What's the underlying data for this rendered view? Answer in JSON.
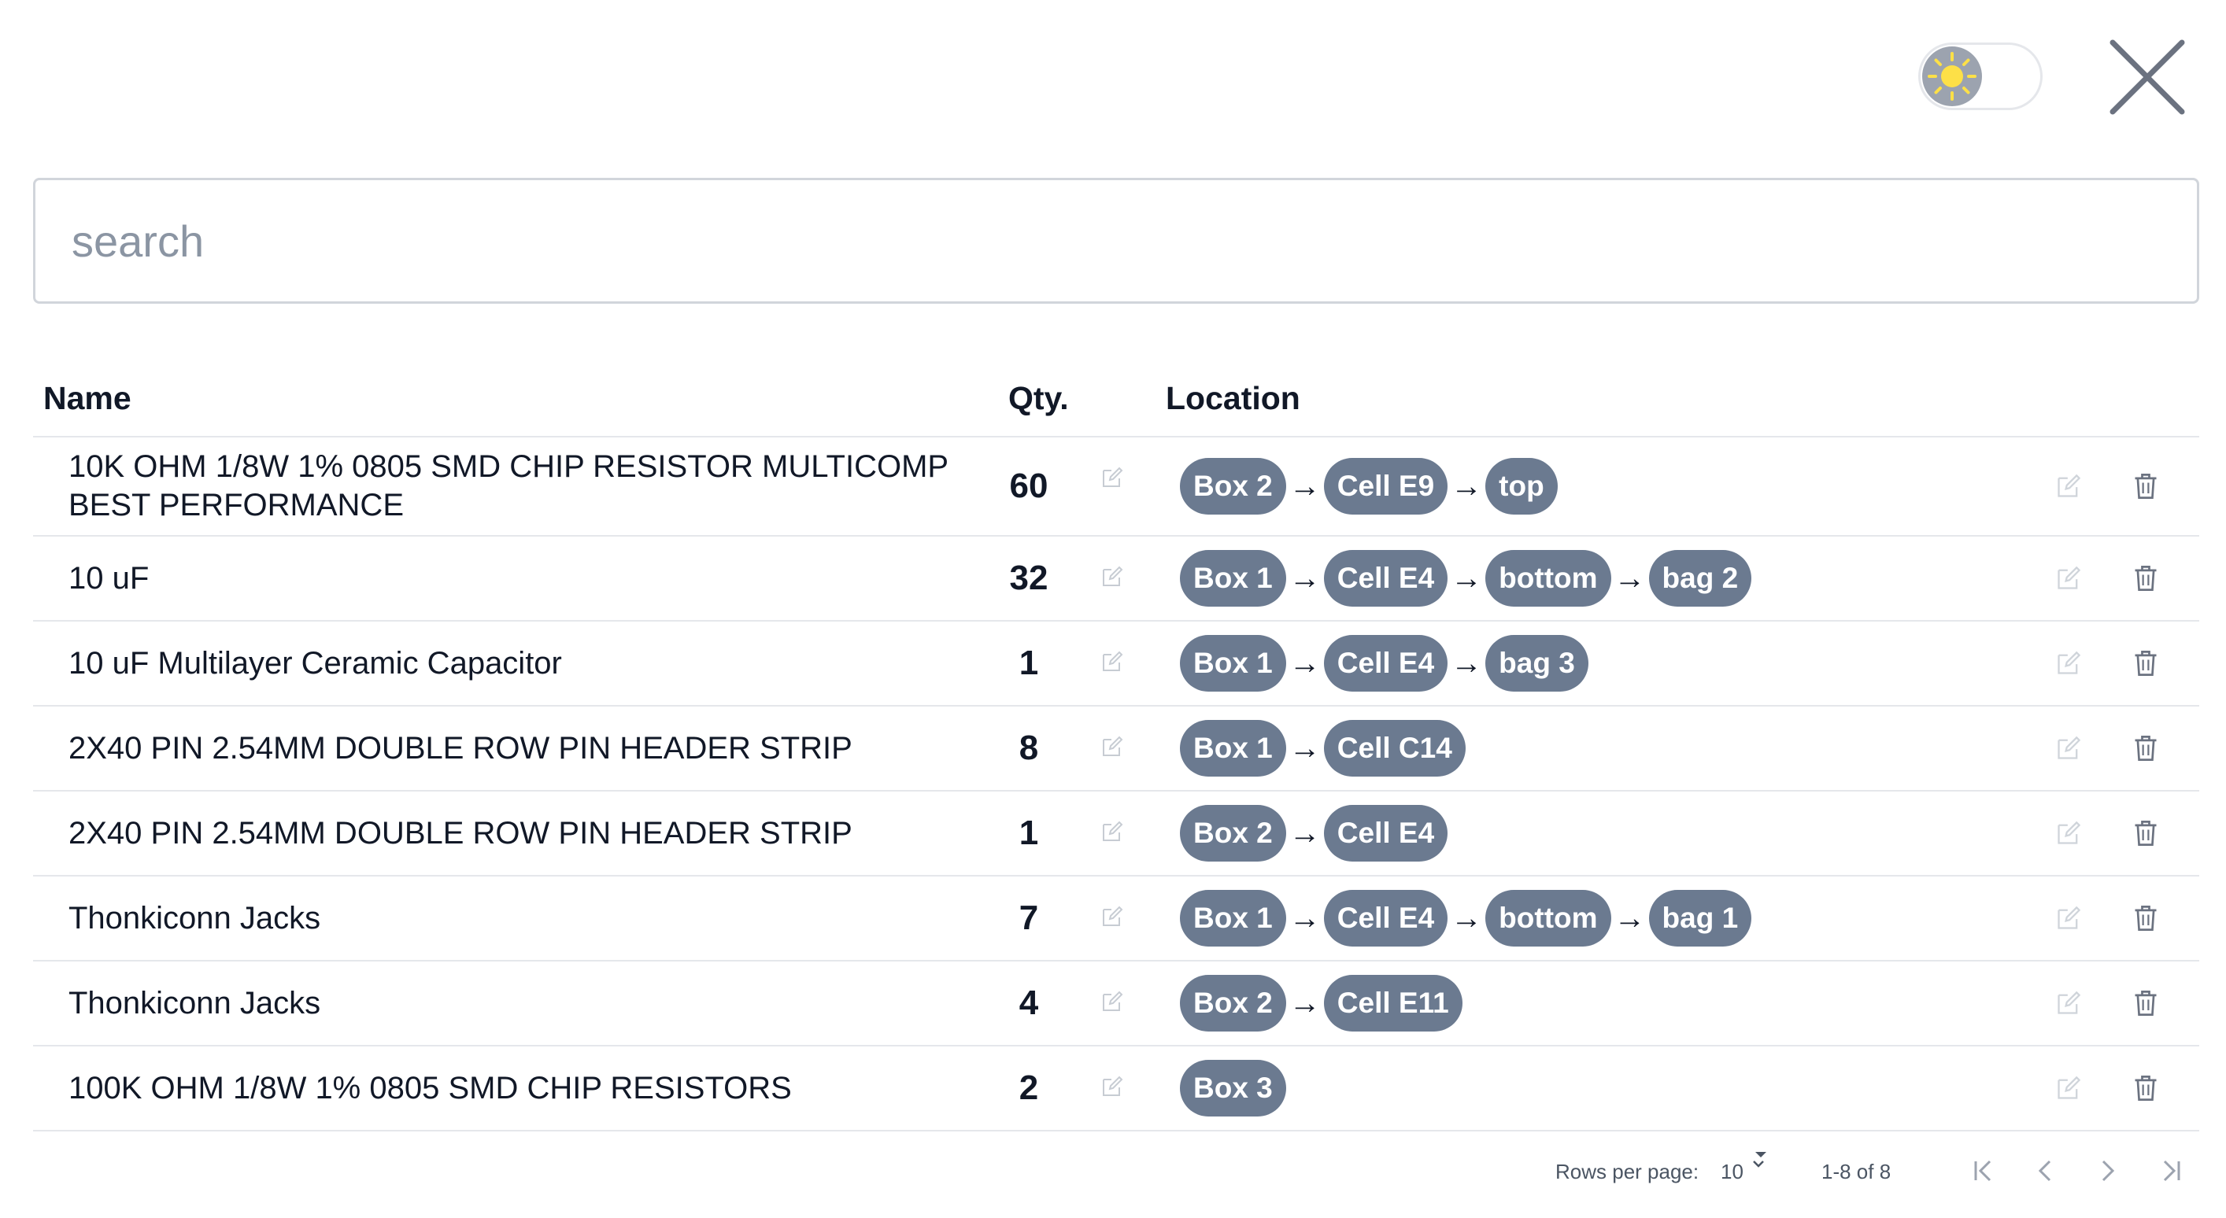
{
  "header": {
    "theme_toggle_icon": "sun-icon",
    "close_icon": "close-icon"
  },
  "search": {
    "placeholder": "search",
    "value": ""
  },
  "table": {
    "headers": {
      "name": "Name",
      "qty": "Qty.",
      "location": "Location"
    },
    "rows": [
      {
        "name": "10K OHM 1/8W 1% 0805 SMD CHIP RESISTOR MULTICOMP BEST PERFORMANCE",
        "qty": "60",
        "location": [
          "Box 2",
          "Cell E9",
          "top"
        ]
      },
      {
        "name": "10 uF",
        "qty": "32",
        "location": [
          "Box 1",
          "Cell E4",
          "bottom",
          "bag 2"
        ]
      },
      {
        "name": "10 uF Multilayer Ceramic Capacitor",
        "qty": "1",
        "location": [
          "Box 1",
          "Cell E4",
          "bag 3"
        ]
      },
      {
        "name": "2X40 PIN 2.54MM DOUBLE ROW PIN HEADER STRIP",
        "qty": "8",
        "location": [
          "Box 1",
          "Cell C14"
        ]
      },
      {
        "name": "2X40 PIN 2.54MM DOUBLE ROW PIN HEADER STRIP",
        "qty": "1",
        "location": [
          "Box 2",
          "Cell E4"
        ]
      },
      {
        "name": "Thonkiconn Jacks",
        "qty": "7",
        "location": [
          "Box 1",
          "Cell E4",
          "bottom",
          "bag 1"
        ]
      },
      {
        "name": "Thonkiconn Jacks",
        "qty": "4",
        "location": [
          "Box 2",
          "Cell E11"
        ]
      },
      {
        "name": "100K OHM 1/8W 1% 0805 SMD CHIP RESISTORS",
        "qty": "2",
        "location": [
          "Box 3"
        ]
      }
    ],
    "location_separator": "→"
  },
  "pagination": {
    "rows_per_page_label": "Rows per page:",
    "rows_per_page_value": "10",
    "range_text": "1-8 of 8"
  },
  "colors": {
    "pill_bg": "#6b7a90",
    "sun": "#fde047",
    "toggle_knob": "#9ca3af",
    "border": "#e5e7eb"
  }
}
